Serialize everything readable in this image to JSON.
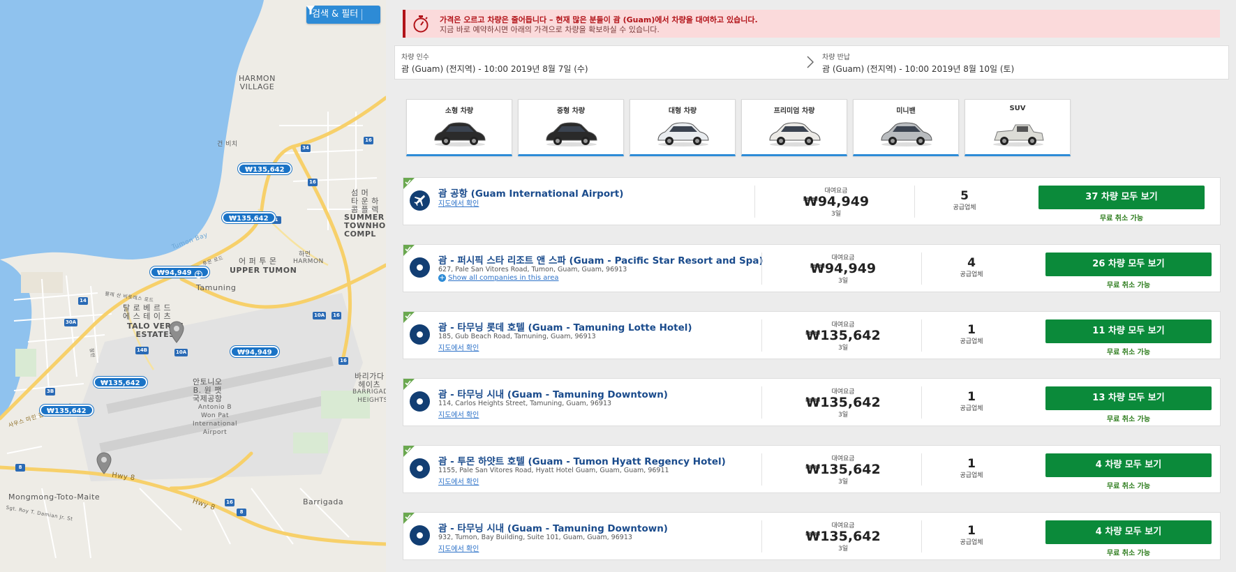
{
  "map": {
    "search_filter_label": "검색 & 필터",
    "labels": {
      "harmon_village": "HARMON\nVILLAGE",
      "gun_beach": "건 비치",
      "tumon_bay": "Tumon Bay",
      "upper_tumon_ko": "어 퍼 투 몬",
      "upper_tumon": "UPPER TUMON",
      "harmon_ko": "하먼",
      "harmon": "HARMON",
      "tamuning": "Tamuning",
      "talo_verde_ko": "탈 로 베 르 드\n에 스 테 이 츠",
      "talo_verde": "TALO VERDE\nESTATES",
      "airport_ko": "안토니오\nB. 원 팻\n국제공항",
      "airport": "Antonio B\nWon Pat\nInternational\nAirport",
      "summer_ko": "섬 머 \n타 운 하\n콤 플 렉",
      "summer": "SUMMER T\nTOWNHO\nCOMPL",
      "barrigada_heights_ko": "바리가다\n헤이츠",
      "barrigada_heights": "BARRIGADA\nHEIGHTS",
      "mongmong": "Mongmong-Toto-Maite",
      "barrigada": "Barrigada",
      "hwy8": "Hwy 8",
      "hwy8b": "Hwy 8",
      "damian": "Sgt. Roy T. Damian Jr. St",
      "marine_drive_ko": "사우스 마린 콥스 드라이브",
      "pale_san_ko": "팔레 산 비토레스 로드",
      "tumon_road_ko": "투몬 로드",
      "hwy16_ko": "잘반"
    },
    "shields": [
      "34",
      "16",
      "1",
      "14",
      "30A",
      "14B",
      "10A",
      "10A",
      "16",
      "16",
      "3B",
      "16",
      "8",
      "8",
      "16"
    ],
    "price_pins": [
      "₩135,642",
      "₩135,642",
      "₩94,949",
      "₩94,949",
      "₩135,642",
      "₩135,642"
    ]
  },
  "alert": {
    "line1": "가격은 오르고 차량은 줄어듭니다 – 현재 많은 분들이 괌 (Guam)에서 차량을 대여하고 있습니다.",
    "line2": "지금 바로 예약하시면 아래의 가격으로 차량을 확보하실 수 있습니다."
  },
  "dates": {
    "pickup_label": "차량 인수",
    "pickup_value": "괌 (Guam) (전지역) - 10:00 2019년 8월 7일 (수)",
    "return_label": "차량 반납",
    "return_value": "괌 (Guam) (전지역) - 10:00 2019년 8월 10일 (토)"
  },
  "categories": [
    {
      "label": "소형 차량",
      "color": "#2b2b2b"
    },
    {
      "label": "중형 차량",
      "color": "#2a2a2a"
    },
    {
      "label": "대형 차량",
      "color": "#e9ecef"
    },
    {
      "label": "프리미엄 차량",
      "color": "#eceae6"
    },
    {
      "label": "미니밴",
      "color": "#b9bcbf"
    },
    {
      "label": "SUV",
      "color": "#dcdcd6"
    }
  ],
  "results": [
    {
      "name": "괌 공항 (Guam International Airport)",
      "address": "",
      "link": "지도에서 확인",
      "price_label": "대여요금",
      "price": "₩94,949",
      "days": "3일",
      "suppliers": "5",
      "supplier_label": "공급업체",
      "button": "37 차량 모두 보기",
      "free": "무료 취소 가능",
      "icon": "airplane"
    },
    {
      "name": "괌 - 퍼시픽 스타 리조트 앤 스파 (Guam - Pacific Star Resort and Spa)",
      "address": "627, Pale San Vitores Road, Tumon, Guam, Guam, 96913",
      "link": "Show all companies in this area",
      "price_label": "대여요금",
      "price": "₩94,949",
      "days": "3일",
      "suppliers": "4",
      "supplier_label": "공급업체",
      "button": "26 차량 모두 보기",
      "free": "무료 취소 가능",
      "icon": "dot"
    },
    {
      "name": "괌 - 타무닝 롯데 호텔 (Guam - Tamuning Lotte Hotel)",
      "address": "185, Gub Beach Road, Tamuning, Guam, 96913",
      "link": "지도에서 확인",
      "price_label": "대여요금",
      "price": "₩135,642",
      "days": "3일",
      "suppliers": "1",
      "supplier_label": "공급업체",
      "button": "11 차량 모두 보기",
      "free": "무료 취소 가능",
      "icon": "dot"
    },
    {
      "name": "괌 - 타무닝 시내 (Guam - Tamuning Downtown)",
      "address": "114, Carlos Heights Street, Tamuning, Guam, 96913",
      "link": "지도에서 확인",
      "price_label": "대여요금",
      "price": "₩135,642",
      "days": "3일",
      "suppliers": "1",
      "supplier_label": "공급업체",
      "button": "13 차량 모두 보기",
      "free": "무료 취소 가능",
      "icon": "dot"
    },
    {
      "name": "괌 - 투몬 하얏트 호텔 (Guam - Tumon Hyatt Regency Hotel)",
      "address": "1155, Pale San Vitores Road, Hyatt Hotel Guam, Guam, Guam, 96911",
      "link": "지도에서 확인",
      "price_label": "대여요금",
      "price": "₩135,642",
      "days": "3일",
      "suppliers": "1",
      "supplier_label": "공급업체",
      "button": "4 차량 모두 보기",
      "free": "무료 취소 가능",
      "icon": "dot"
    },
    {
      "name": "괌 - 타무닝 시내 (Guam - Tamuning Downtown)",
      "address": "932, Tumon, Bay Building, Suite 101, Guam, Guam, 96913",
      "link": "지도에서 확인",
      "price_label": "대여요금",
      "price": "₩135,642",
      "days": "3일",
      "suppliers": "1",
      "supplier_label": "공급업체",
      "button": "4 차량 모두 보기",
      "free": "무료 취소 가능",
      "icon": "dot"
    }
  ],
  "colors": {
    "accent_blue": "#2d8bd6",
    "button_green": "#0b8a3a",
    "alert_red": "#b21319",
    "alert_bg": "#fbdadb",
    "link_blue": "#1a4b8c",
    "water": "#8fc2ee"
  }
}
